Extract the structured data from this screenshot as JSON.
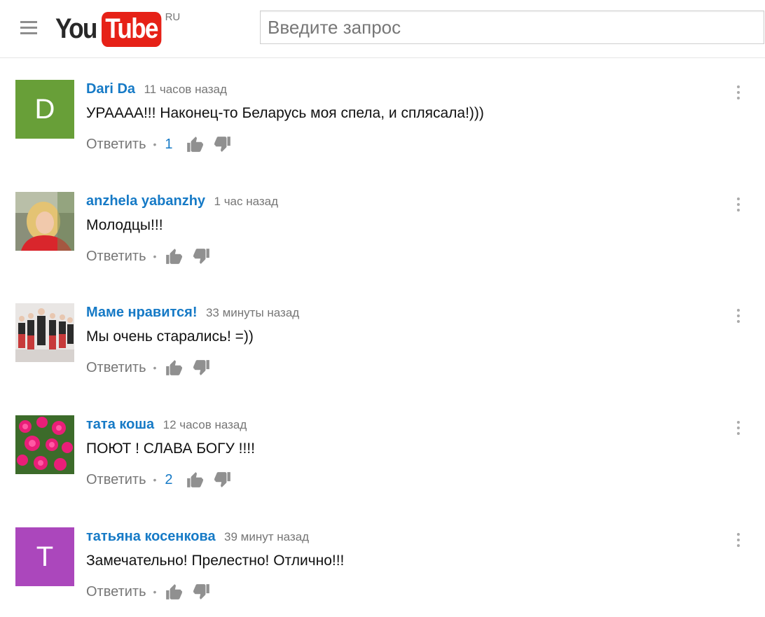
{
  "header": {
    "logo_you": "You",
    "logo_tube": "Tube",
    "logo_region": "RU",
    "search_placeholder": "Введите запрос",
    "logo_tube_color": "#e62117"
  },
  "comments": [
    {
      "author": "Dari Da",
      "time": "11 часов назад",
      "text": "УРАААА!!! Наконец-то Беларусь моя спела, и сплясала!)))",
      "reply_label": "Ответить",
      "likes": "1",
      "avatar_letter": "D",
      "avatar_color": "#689f38"
    },
    {
      "author": "anzhela yabanzhy",
      "time": "1 час назад",
      "text": "Молодцы!!!",
      "reply_label": "Ответить",
      "likes": ""
    },
    {
      "author": "Маме нравится!",
      "time": "33 минуты назад",
      "text": "Мы очень старались! =))",
      "reply_label": "Ответить",
      "likes": ""
    },
    {
      "author": "тата коша",
      "time": "12 часов назад",
      "text": "ПОЮТ ! СЛАВА БОГУ !!!!",
      "reply_label": "Ответить",
      "likes": "2"
    },
    {
      "author": "татьяна косенкова",
      "time": "39 минут назад",
      "text": "Замечательно! Прелестно! Отлично!!!",
      "reply_label": "Ответить",
      "likes": "",
      "avatar_letter": "T",
      "avatar_color": "#ab47bc"
    }
  ],
  "colors": {
    "author_link": "#167ac6",
    "meta_text": "#767676"
  }
}
